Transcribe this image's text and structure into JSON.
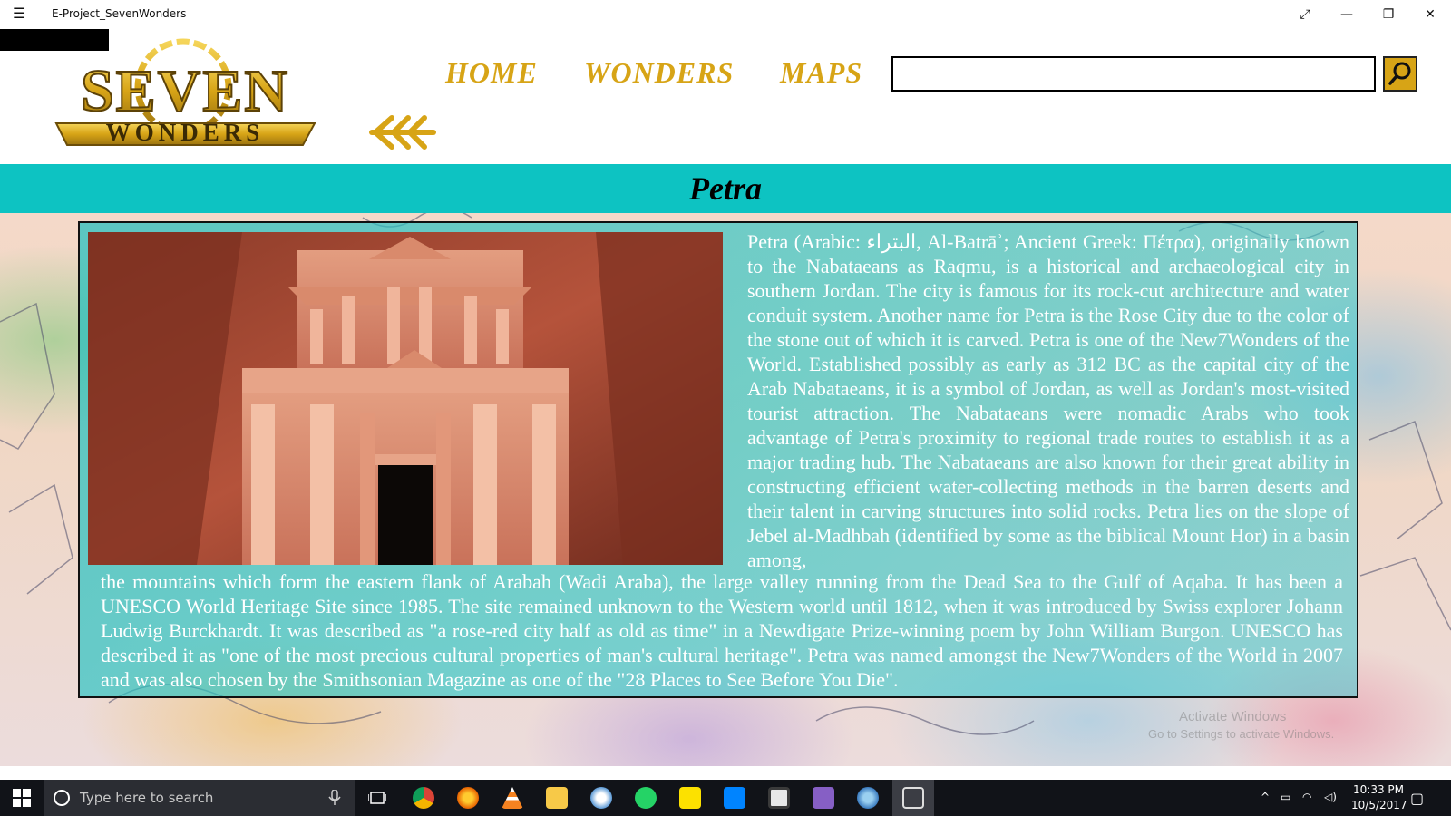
{
  "window": {
    "title": "E-Project_SevenWonders",
    "controls": {
      "fullscreen": "⤢",
      "minimize": "—",
      "restore": "❐",
      "close": "✕"
    }
  },
  "logo": {
    "line1": "SEVEN",
    "line2": "WONDERS"
  },
  "nav": {
    "items": [
      "HOME",
      "WONDERS",
      "MAPS"
    ]
  },
  "search": {
    "value": "",
    "placeholder": ""
  },
  "banner": {
    "title": "Petra"
  },
  "article": {
    "paragraph1": "Petra (Arabic: البتراء, Al-Batrāʾ; Ancient Greek: Πέτρα), originally known to the Nabataeans as Raqmu, is a historical and archaeological city in southern Jordan. The city is famous for its rock-cut architecture and water conduit system. Another name for Petra is the Rose City due to the color of the stone out of which it is carved. Petra is one of the New7Wonders of the World. Established possibly as early as 312 BC as the capital city of the Arab Nabataeans, it is a symbol of Jordan, as well as Jordan's most-visited tourist attraction. The Nabataeans were nomadic Arabs who took advantage of Petra's proximity to regional trade routes to establish it as a major trading hub. The Nabataeans are also known for their great ability in constructing efficient water-collecting methods in the barren deserts and their talent in carving structures into solid rocks.  Petra lies on the slope of Jebel al-Madhbah (identified by some as the biblical Mount Hor) in a basin among,",
    "paragraph2": "the mountains which form the eastern flank of Arabah (Wadi Araba), the large valley running from the Dead Sea to the Gulf of Aqaba. It has been a UNESCO World Heritage Site since 1985. The site remained unknown to the Western world until 1812, when it was introduced by Swiss explorer Johann Ludwig Burckhardt. It was described as \"a rose-red city half as old as time\" in a Newdigate Prize-winning poem by John William Burgon. UNESCO has described it as \"one of the most precious cultural properties of man's cultural heritage\". Petra was named amongst the New7Wonders of the World in 2007 and was also chosen by the Smithsonian Magazine as one of the \"28 Places to See Before You Die\"."
  },
  "watermark": {
    "line1": "Activate Windows",
    "line2": "Go to Settings to activate Windows."
  },
  "taskbar": {
    "search_placeholder": "Type here to search",
    "time": "10:33 PM",
    "date": "10/5/2017",
    "apps": [
      "chrome-icon",
      "firefox-icon",
      "vlc-icon",
      "file-explorer-icon",
      "paint-icon",
      "whatsapp-icon",
      "sticky-notes-icon",
      "messenger-icon",
      "calculator-icon",
      "visual-studio-icon",
      "paint-brush-icon",
      "app-window-icon"
    ]
  },
  "colors": {
    "accent_gold": "#d7a416",
    "banner_teal": "#0dc3c2",
    "taskbar": "#111318"
  }
}
